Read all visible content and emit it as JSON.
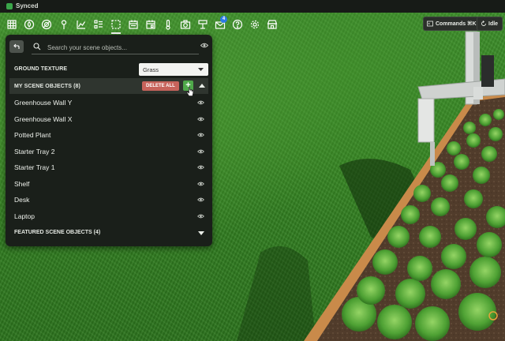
{
  "app": {
    "sync_status": "Synced"
  },
  "toolbar": {
    "icons": [
      "grid-icon",
      "leaf-icon",
      "target-icon",
      "sensor-pin-icon",
      "chart-icon",
      "list-icon",
      "select-box-icon",
      "calendar-icon",
      "calendar-event-icon",
      "thermometer-icon",
      "camera-icon",
      "scale-icon",
      "messages-icon",
      "help-icon",
      "settings-icon",
      "store-icon"
    ],
    "message_badge": "4"
  },
  "top_right": {
    "commands_label": "Commands ⌘K",
    "idle_label": "Idle"
  },
  "panel": {
    "search": {
      "placeholder": "Search your scene objects...",
      "value": ""
    },
    "ground_texture": {
      "label": "GROUND TEXTURE",
      "selected": "Grass"
    },
    "my_scene_objects": {
      "label": "MY SCENE OBJECTS (8)",
      "delete_all_label": "DELETE ALL",
      "add_label": "+",
      "items": [
        {
          "label": "Greenhouse Wall Y"
        },
        {
          "label": "Greenhouse Wall X"
        },
        {
          "label": "Potted Plant"
        },
        {
          "label": "Starter Tray 2"
        },
        {
          "label": "Starter Tray 1"
        },
        {
          "label": "Shelf"
        },
        {
          "label": "Desk"
        },
        {
          "label": "Laptop"
        }
      ]
    },
    "featured_scene_objects": {
      "label": "FEATURED SCENE OBJECTS (4)"
    }
  },
  "colors": {
    "panel_bg": "#1a1f1a",
    "accent_green": "#4fa84a",
    "delete_red": "#c7635b",
    "grass": "#348322"
  }
}
